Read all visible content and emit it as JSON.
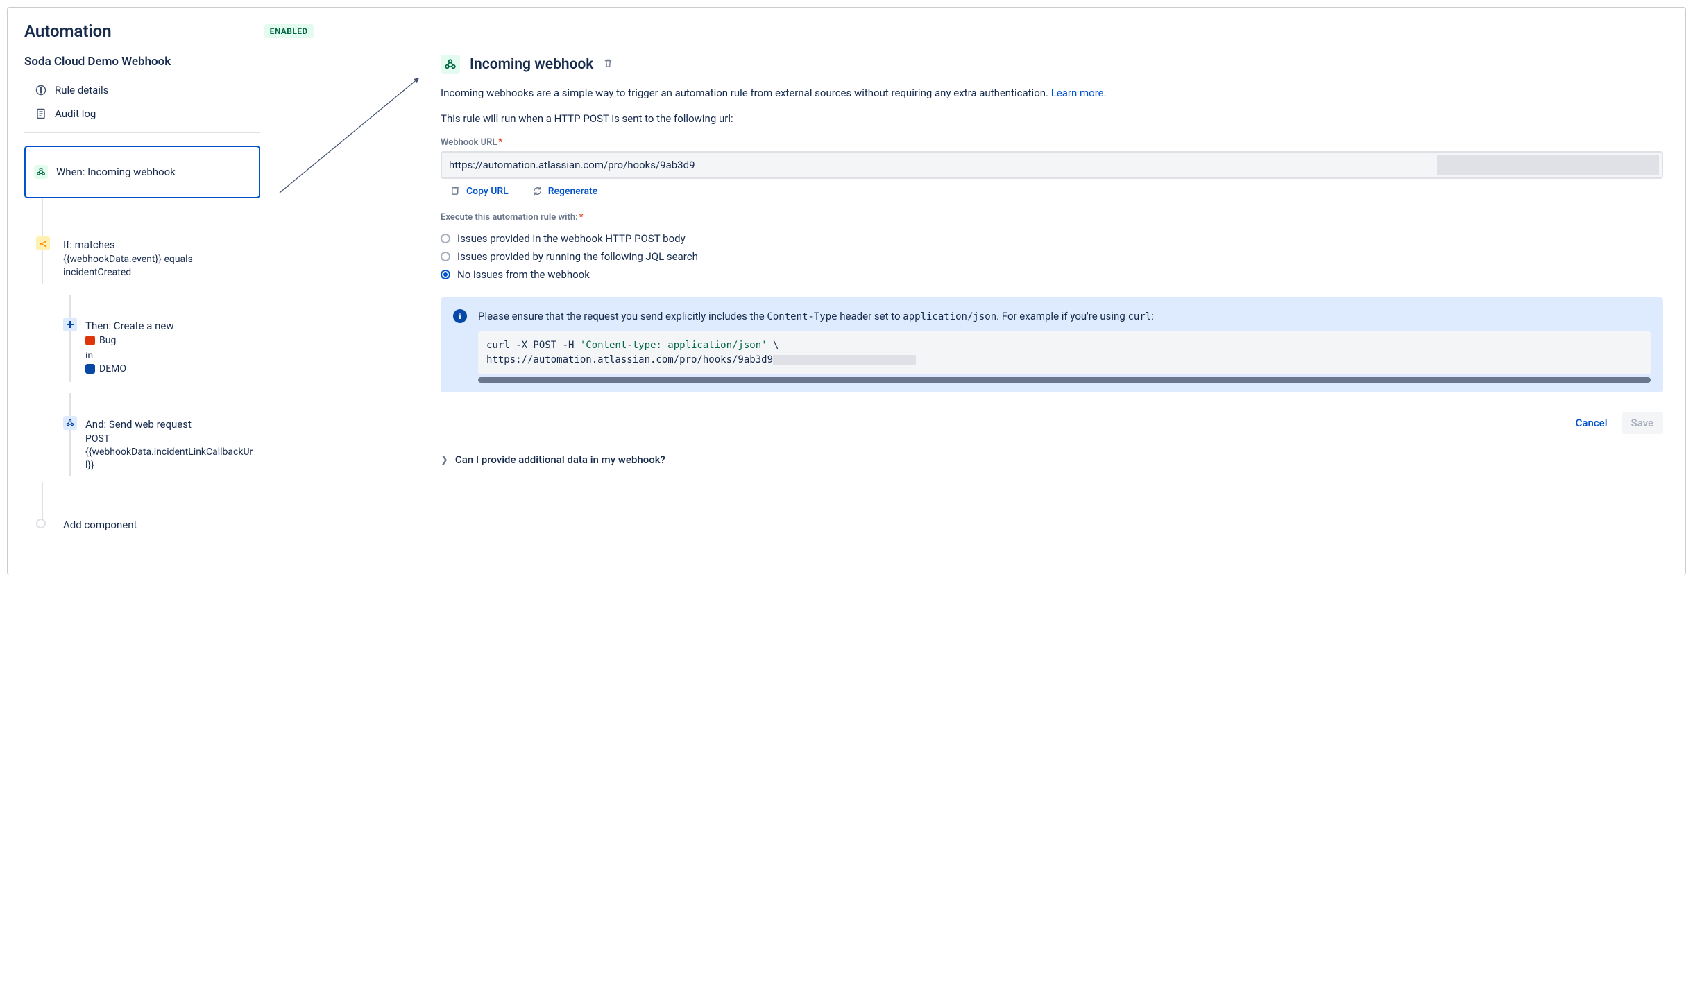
{
  "header": {
    "title": "Automation",
    "status": "ENABLED"
  },
  "left": {
    "rule_name": "Soda Cloud Demo Webhook",
    "nav_rule_details": "Rule details",
    "nav_audit_log": "Audit log",
    "when_label": "When: Incoming webhook",
    "if": {
      "title": "If: matches",
      "desc": "{{webhookData.event}} equals incidentCreated"
    },
    "then": {
      "title": "Then: Create a new",
      "bug_label": "Bug",
      "in_label": "in",
      "project_label": "DEMO"
    },
    "and": {
      "title": "And: Send web request",
      "method": "POST",
      "url_expr": "{{webhookData.incidentLinkCallbackUrl}}"
    },
    "add_component": "Add component"
  },
  "right": {
    "title": "Incoming webhook",
    "p1_a": "Incoming webhooks are a simple way to trigger an automation rule from external sources without requiring any extra authentication. ",
    "p1_link": "Learn more",
    "p1_dot": ".",
    "p2": "This rule will run when a HTTP POST is sent to the following url:",
    "url_label": "Webhook URL",
    "url_value": "https://automation.atlassian.com/pro/hooks/9ab3d9",
    "copy_url": "Copy URL",
    "regenerate": "Regenerate",
    "exec_label": "Execute this automation rule with:",
    "radio1": "Issues provided in the webhook HTTP POST body",
    "radio2": "Issues provided by running the following JQL search",
    "radio3": "No issues from the webhook",
    "info_a": "Please ensure that the request you send explicitly includes the ",
    "info_code1": "Content-Type",
    "info_b": " header set to ",
    "info_code2": "application/json",
    "info_c": ". For example if you're using ",
    "info_code3": "curl",
    "info_d": ":",
    "code_line1a": "curl -X POST -H ",
    "code_line1b": "'Content-type: application/json'",
    "code_line1c": " \\",
    "code_line2": "https://automation.atlassian.com/pro/hooks/9ab3d9",
    "cancel": "Cancel",
    "save": "Save",
    "expander": "Can I provide additional data in my webhook?"
  }
}
